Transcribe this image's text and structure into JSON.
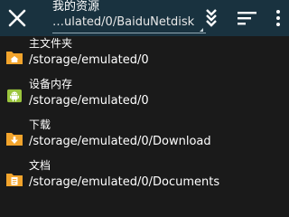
{
  "toolbar": {
    "title": "我的资源",
    "current_path": "…ulated/0/BaiduNetdisk"
  },
  "icons": {
    "close": "close-icon",
    "download": "download-icon",
    "sort": "sort-icon",
    "overflow": "more-vertical-icon"
  },
  "colors": {
    "toolbar_bg": "#19323f",
    "list_bg": "#1a1a1a",
    "folder_orange": "#f2a42c",
    "android_green": "#9bc53d"
  },
  "locations": [
    {
      "name": "主文件夹",
      "path": "/storage/emulated/0",
      "icon": "home-folder-icon"
    },
    {
      "name": "设备内存",
      "path": "/storage/emulated/0",
      "icon": "android-device-icon"
    },
    {
      "name": "下载",
      "path": "/storage/emulated/0/Download",
      "icon": "download-folder-icon"
    },
    {
      "name": "文档",
      "path": "/storage/emulated/0/Documents",
      "icon": "documents-folder-icon"
    }
  ]
}
